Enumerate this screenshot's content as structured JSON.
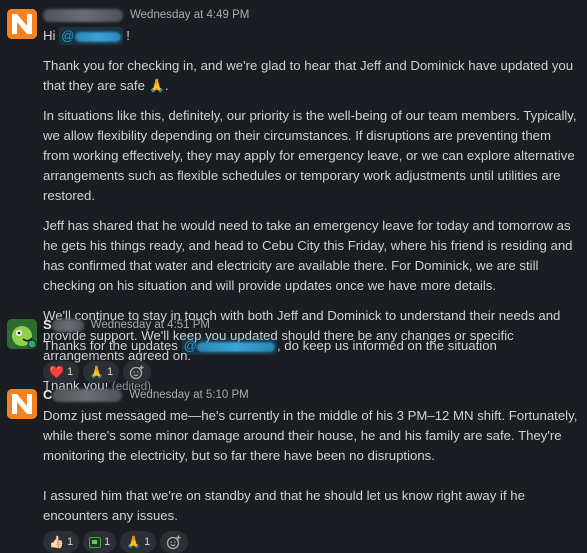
{
  "colors": {
    "background": "#1a1d21",
    "text": "#d1d2d3",
    "mention": "#1d9bd1",
    "avatar_orange": "#f58220",
    "avatar_green": "#2f6b2f"
  },
  "messages": [
    {
      "author_initial": "",
      "timestamp": "Wednesday at 4:49 PM",
      "greeting_prefix": "Hi",
      "greeting_suffix": "!",
      "paragraphs": [
        "Thank you for checking in, and we're glad to hear that Jeff and Dominick have updated you that they are safe 🙏.",
        "In situations like this, definitely, our priority is the well-being of our team members. Typically, we allow flexibility depending on their circumstances. If disruptions are preventing them from working effectively, they may apply for emergency leave, or we can explore alternative arrangements such as flexible schedules or temporary work adjustments until utilities are restored.",
        "Jeff has shared that he would need to take an emergency leave for today and tomorrow as he gets his things ready, and head to Cebu City this Friday, where his friend is residing and has confirmed that water and electricity are available there. For Dominick, we are still checking on his situation and will provide updates once we have more details.",
        "We'll continue to stay in touch with both Jeff and Dominick to understand their needs and provide support. We'll keep you updated should there be any changes or specific arrangements agreed on."
      ],
      "closing": "Thank you!",
      "edited_label": "(edited)"
    },
    {
      "author_initial": "S",
      "timestamp": "Wednesday at 4:51 PM",
      "text_prefix": "Thanks for the updates",
      "text_suffix": ", do keep us informed on the situation",
      "reactions": [
        {
          "emoji": "❤️",
          "icon": "heart-icon",
          "count": "1"
        },
        {
          "emoji": "🙏",
          "icon": "pray-icon",
          "count": "1"
        }
      ]
    },
    {
      "author_initial": "C",
      "timestamp": "Wednesday at 5:10 PM",
      "paragraphs": [
        "Domz just messaged me—he's currently in the middle of his 3 PM–12 MN shift. Fortunately, while there's some minor damage around their house, he and his family are safe. They're monitoring the electricity, but so far there have been no disruptions.",
        "I assured him that we're on standby and that he should let us know right away if he encounters any issues."
      ],
      "reactions": [
        {
          "emoji": "👍🏻",
          "icon": "thumbs-up-icon",
          "count": "1"
        },
        {
          "emoji": "",
          "icon": "tv-icon",
          "count": "1"
        },
        {
          "emoji": "🙏",
          "icon": "pray-icon",
          "count": "1"
        }
      ]
    }
  ]
}
